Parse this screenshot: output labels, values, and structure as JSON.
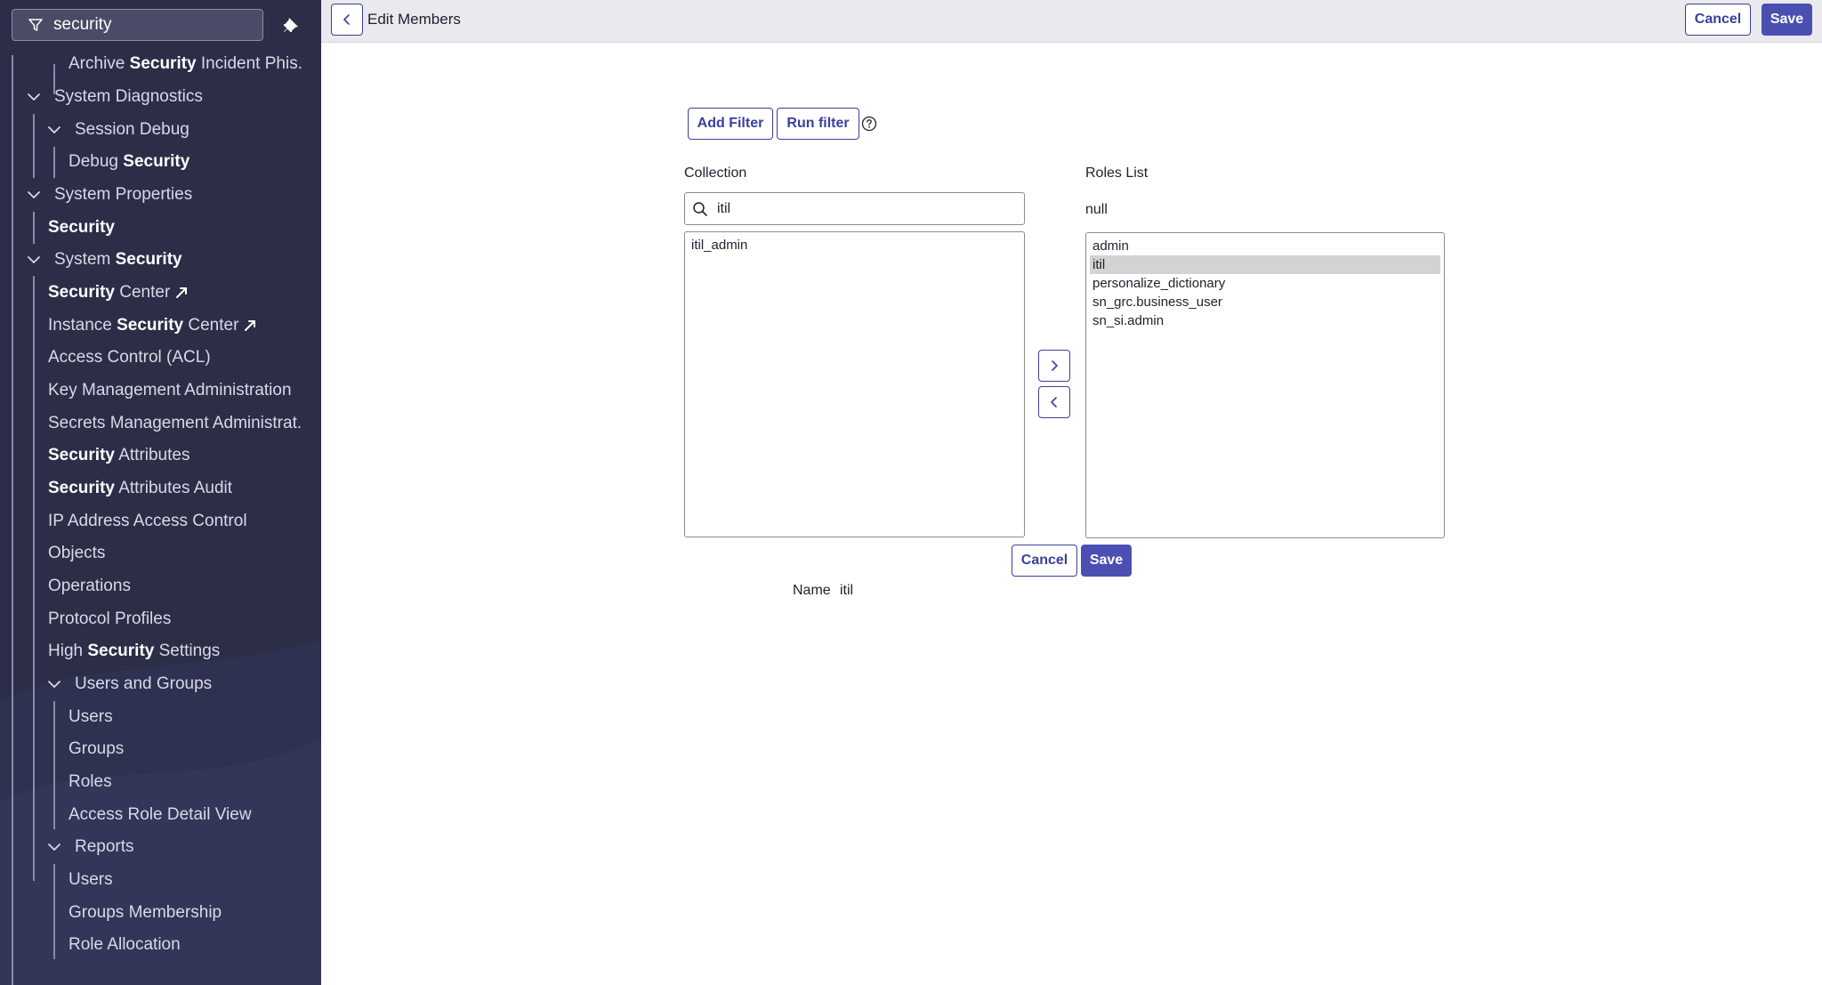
{
  "sidebar": {
    "filter": {
      "value": "security",
      "icon": "funnel-icon"
    },
    "pin_icon": "pin-icon",
    "items": [
      {
        "parts": [
          {
            "t": "Archive ",
            "b": false
          },
          {
            "t": "Security",
            "b": true
          },
          {
            "t": " Incident Phis...",
            "b": false
          }
        ]
      },
      {
        "parts": [
          {
            "t": "System Diagnostics",
            "b": false
          }
        ]
      },
      {
        "parts": [
          {
            "t": "Session Debug",
            "b": false
          }
        ]
      },
      {
        "parts": [
          {
            "t": "Debug ",
            "b": false
          },
          {
            "t": "Security",
            "b": true
          }
        ]
      },
      {
        "parts": [
          {
            "t": "System Properties",
            "b": false
          }
        ]
      },
      {
        "parts": [
          {
            "t": "Security",
            "b": true
          }
        ]
      },
      {
        "parts": [
          {
            "t": "System ",
            "b": false
          },
          {
            "t": "Security",
            "b": true
          }
        ]
      },
      {
        "parts": [
          {
            "t": "Security",
            "b": true
          },
          {
            "t": " Center",
            "b": false
          }
        ]
      },
      {
        "parts": [
          {
            "t": "Instance ",
            "b": false
          },
          {
            "t": "Security",
            "b": true
          },
          {
            "t": " Center",
            "b": false
          }
        ]
      },
      {
        "parts": [
          {
            "t": "Access Control (ACL)",
            "b": false
          }
        ]
      },
      {
        "parts": [
          {
            "t": "Key Management Administration",
            "b": false
          }
        ]
      },
      {
        "parts": [
          {
            "t": "Secrets Management Administrat...",
            "b": false
          }
        ]
      },
      {
        "parts": [
          {
            "t": "Security",
            "b": true
          },
          {
            "t": " Attributes",
            "b": false
          }
        ]
      },
      {
        "parts": [
          {
            "t": "Security",
            "b": true
          },
          {
            "t": " Attributes Audit",
            "b": false
          }
        ]
      },
      {
        "parts": [
          {
            "t": "IP Address Access Control",
            "b": false
          }
        ]
      },
      {
        "parts": [
          {
            "t": "Objects",
            "b": false
          }
        ]
      },
      {
        "parts": [
          {
            "t": "Operations",
            "b": false
          }
        ]
      },
      {
        "parts": [
          {
            "t": "Protocol Profiles",
            "b": false
          }
        ]
      },
      {
        "parts": [
          {
            "t": "High ",
            "b": false
          },
          {
            "t": "Security",
            "b": true
          },
          {
            "t": " Settings",
            "b": false
          }
        ]
      },
      {
        "parts": [
          {
            "t": "Users and Groups",
            "b": false
          }
        ]
      },
      {
        "parts": [
          {
            "t": "Users",
            "b": false
          }
        ]
      },
      {
        "parts": [
          {
            "t": "Groups",
            "b": false
          }
        ]
      },
      {
        "parts": [
          {
            "t": "Roles",
            "b": false
          }
        ]
      },
      {
        "parts": [
          {
            "t": "Access Role Detail View",
            "b": false
          }
        ]
      },
      {
        "parts": [
          {
            "t": "Reports",
            "b": false
          }
        ]
      },
      {
        "parts": [
          {
            "t": "Users",
            "b": false
          }
        ]
      },
      {
        "parts": [
          {
            "t": "Groups Membership",
            "b": false
          }
        ]
      },
      {
        "parts": [
          {
            "t": "Role Allocation",
            "b": false
          }
        ]
      }
    ]
  },
  "header": {
    "title": "Edit Members",
    "back_icon": "chevron-left-icon",
    "cancel_label": "Cancel",
    "save_label": "Save"
  },
  "toolbar": {
    "add_filter_label": "Add Filter",
    "run_filter_label": "Run filter",
    "help_icon": "help-icon"
  },
  "collection": {
    "label": "Collection",
    "search_value": "itil",
    "options": [
      "itil_admin"
    ]
  },
  "roles": {
    "label": "Roles List",
    "subtitle": "null",
    "options": [
      "admin",
      "itil",
      "personalize_dictionary",
      "sn_grc.business_user",
      "sn_si.admin"
    ],
    "selected": "itil"
  },
  "move": {
    "add_icon": "chevron-right-icon",
    "remove_icon": "chevron-left-icon"
  },
  "footer": {
    "cancel_label": "Cancel",
    "save_label": "Save",
    "name_label": "Name",
    "name_value": "itil"
  },
  "colors": {
    "sidebar_bg": "#2c2d47",
    "accent": "#4b4fb2",
    "header_bg": "#e9e9ee",
    "selected_option": "#d3d3d3"
  }
}
